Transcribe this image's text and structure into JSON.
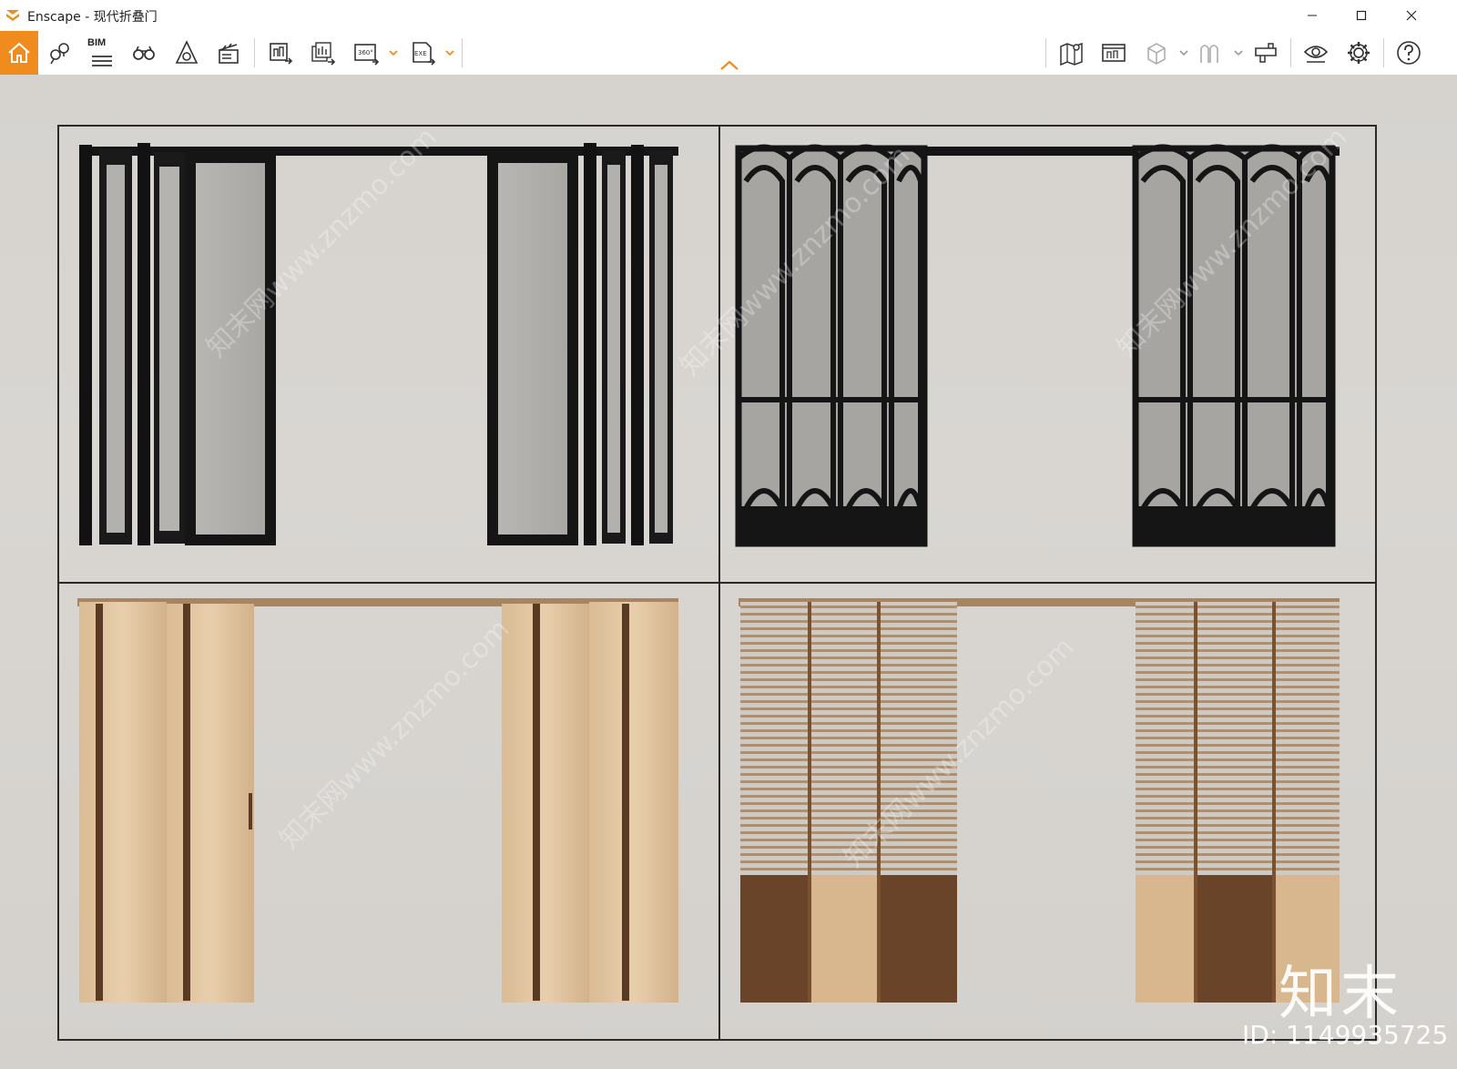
{
  "window": {
    "app_name": "Enscape",
    "title": "Enscape - 现代折叠门",
    "minimize_icon": "minimize-icon",
    "maximize_icon": "maximize-icon",
    "close_icon": "close-icon"
  },
  "toolbar": {
    "accent_color": "#f08c1e",
    "left_tools": [
      {
        "name": "home-icon"
      },
      {
        "name": "location-pins-icon"
      },
      {
        "name": "bim-icon",
        "label": "BIM"
      },
      {
        "name": "binoculars-icon"
      },
      {
        "name": "material-editor-icon"
      },
      {
        "name": "clapperboard-icon"
      }
    ],
    "export_tools": [
      {
        "name": "render-image-icon"
      },
      {
        "name": "batch-render-icon"
      },
      {
        "name": "panorama-360-icon",
        "label": "360°"
      },
      {
        "name": "export-exe-icon",
        "label": "EXE"
      }
    ],
    "right_tools": [
      {
        "name": "map-view-icon"
      },
      {
        "name": "asset-library-icon"
      },
      {
        "name": "cube-icon"
      },
      {
        "name": "section-icon"
      },
      {
        "name": "collaboration-icon"
      },
      {
        "name": "visual-settings-icon"
      },
      {
        "name": "gear-icon"
      },
      {
        "name": "help-icon"
      }
    ]
  },
  "viewport": {
    "wall_color": "#d6d3cf",
    "panels": [
      {
        "name": "black-framed-glass-folding-door",
        "frame_color": "#1b1b1b"
      },
      {
        "name": "black-arched-lattice-folding-door",
        "frame_color": "#1b1b1b"
      },
      {
        "name": "light-wood-panel-folding-door",
        "wood_color": "#e2c7a2"
      },
      {
        "name": "wood-slat-louver-folding-door",
        "wood_color": "#d8b78e",
        "dark_wood": "#6a4428"
      }
    ],
    "watermark": {
      "logo_text": "知末",
      "id_text": "ID: 1149935725",
      "site_text": "知末网www.znzmo.com"
    }
  }
}
